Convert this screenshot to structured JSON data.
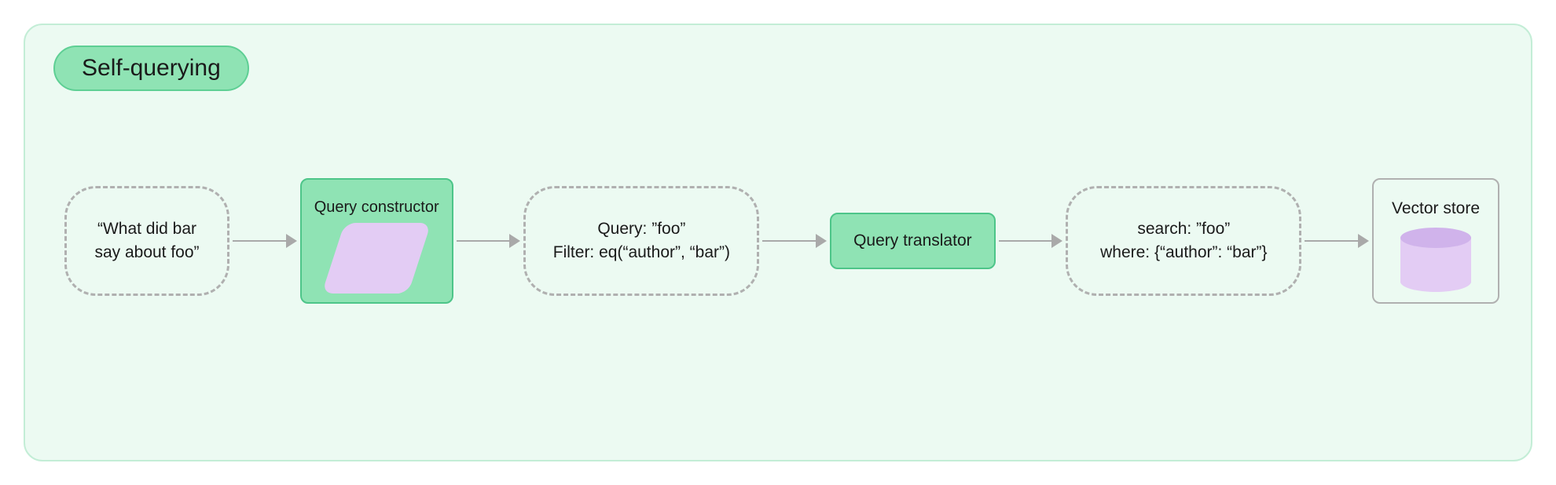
{
  "title": "Self-querying",
  "nodes": {
    "input": {
      "line1": "“What did bar",
      "line2": "say about foo”"
    },
    "constructor": {
      "label": "Query constructor"
    },
    "structured": {
      "line1": "Query: ”foo”",
      "line2": "Filter: eq(“author”, “bar”)"
    },
    "translator": {
      "label": "Query translator"
    },
    "translated": {
      "line1": "search: ”foo”",
      "line2": "where: {“author”: “bar”}"
    },
    "store": {
      "label": "Vector store"
    }
  }
}
